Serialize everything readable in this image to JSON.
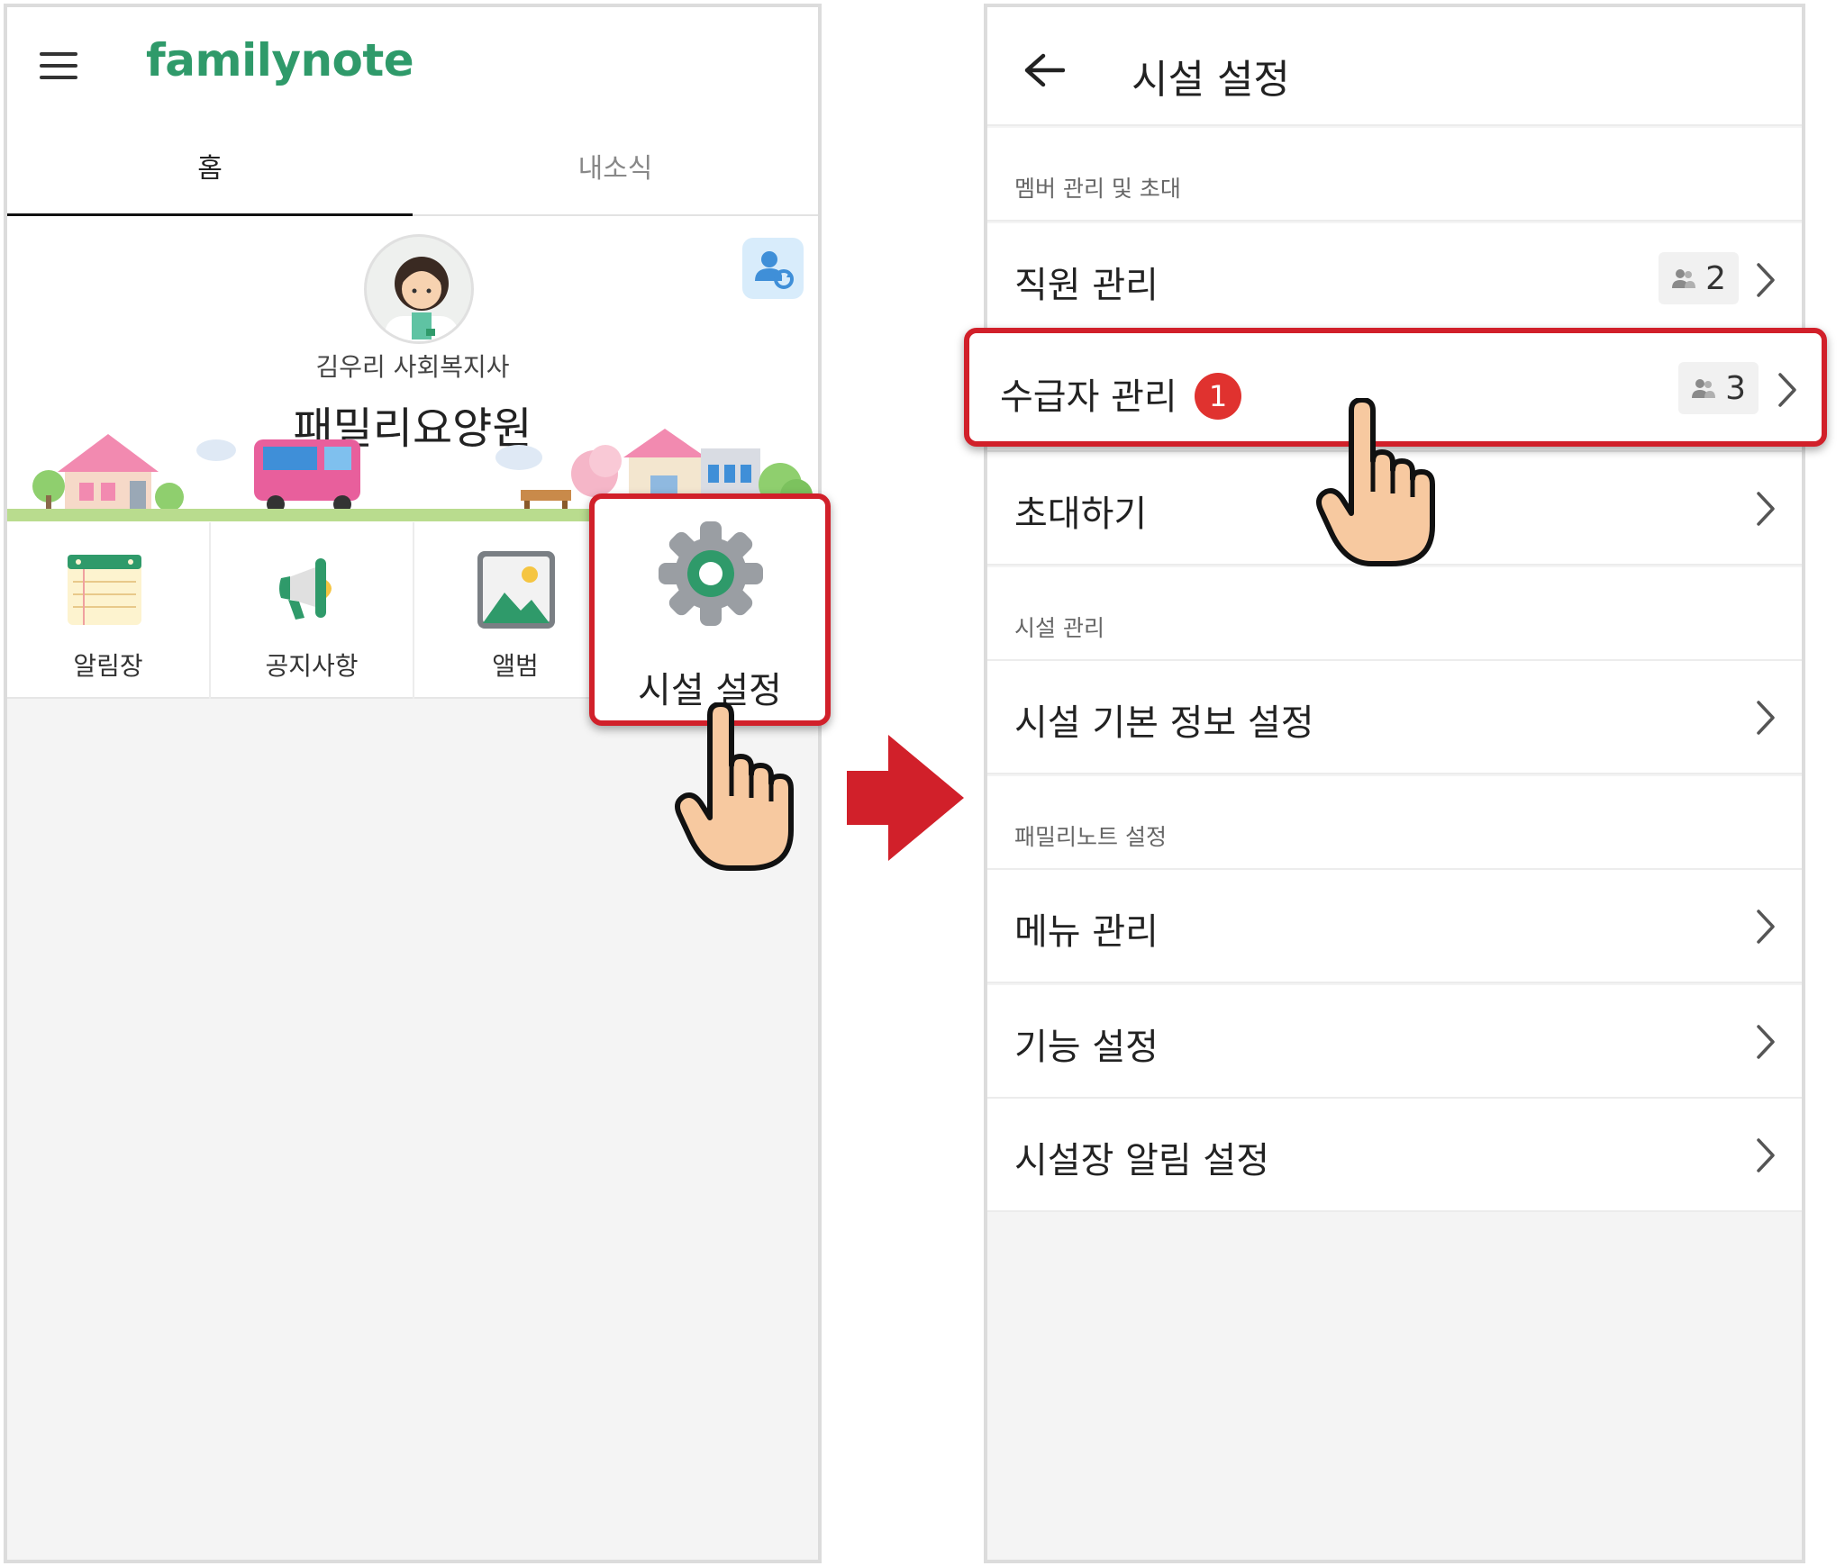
{
  "left_screen": {
    "logo": "familynote",
    "tabs": [
      "홈",
      "내소식"
    ],
    "role": "김우리 사회복지사",
    "facility_name": "패밀리요양원",
    "menu": [
      "알림장",
      "공지사항",
      "앨범",
      "시설 설정"
    ],
    "icons": [
      "hamburger-icon",
      "profile-switch-icon",
      "notebook-icon",
      "megaphone-icon",
      "photo-icon",
      "gear-icon"
    ]
  },
  "right_screen": {
    "title": "시설 설정",
    "sections": [
      {
        "header": "멤버 관리 및 초대",
        "items": [
          {
            "label": "직원 관리",
            "count": "2"
          },
          {
            "label": "수급자 관리",
            "count": "3",
            "badge": "1"
          },
          {
            "label": "초대하기"
          }
        ]
      },
      {
        "header": "시설 관리",
        "items": [
          {
            "label": "시설 기본 정보 설정"
          }
        ]
      },
      {
        "header": "패밀리노트 설정",
        "items": [
          {
            "label": "메뉴 관리"
          },
          {
            "label": "기능 설정"
          },
          {
            "label": "시설장 알림 설정"
          }
        ]
      }
    ]
  },
  "colors": {
    "brand_green": "#2f9a6a",
    "highlight_red": "#d1202a",
    "badge_red": "#e0322f",
    "hand_skin": "#f7c9a0"
  }
}
